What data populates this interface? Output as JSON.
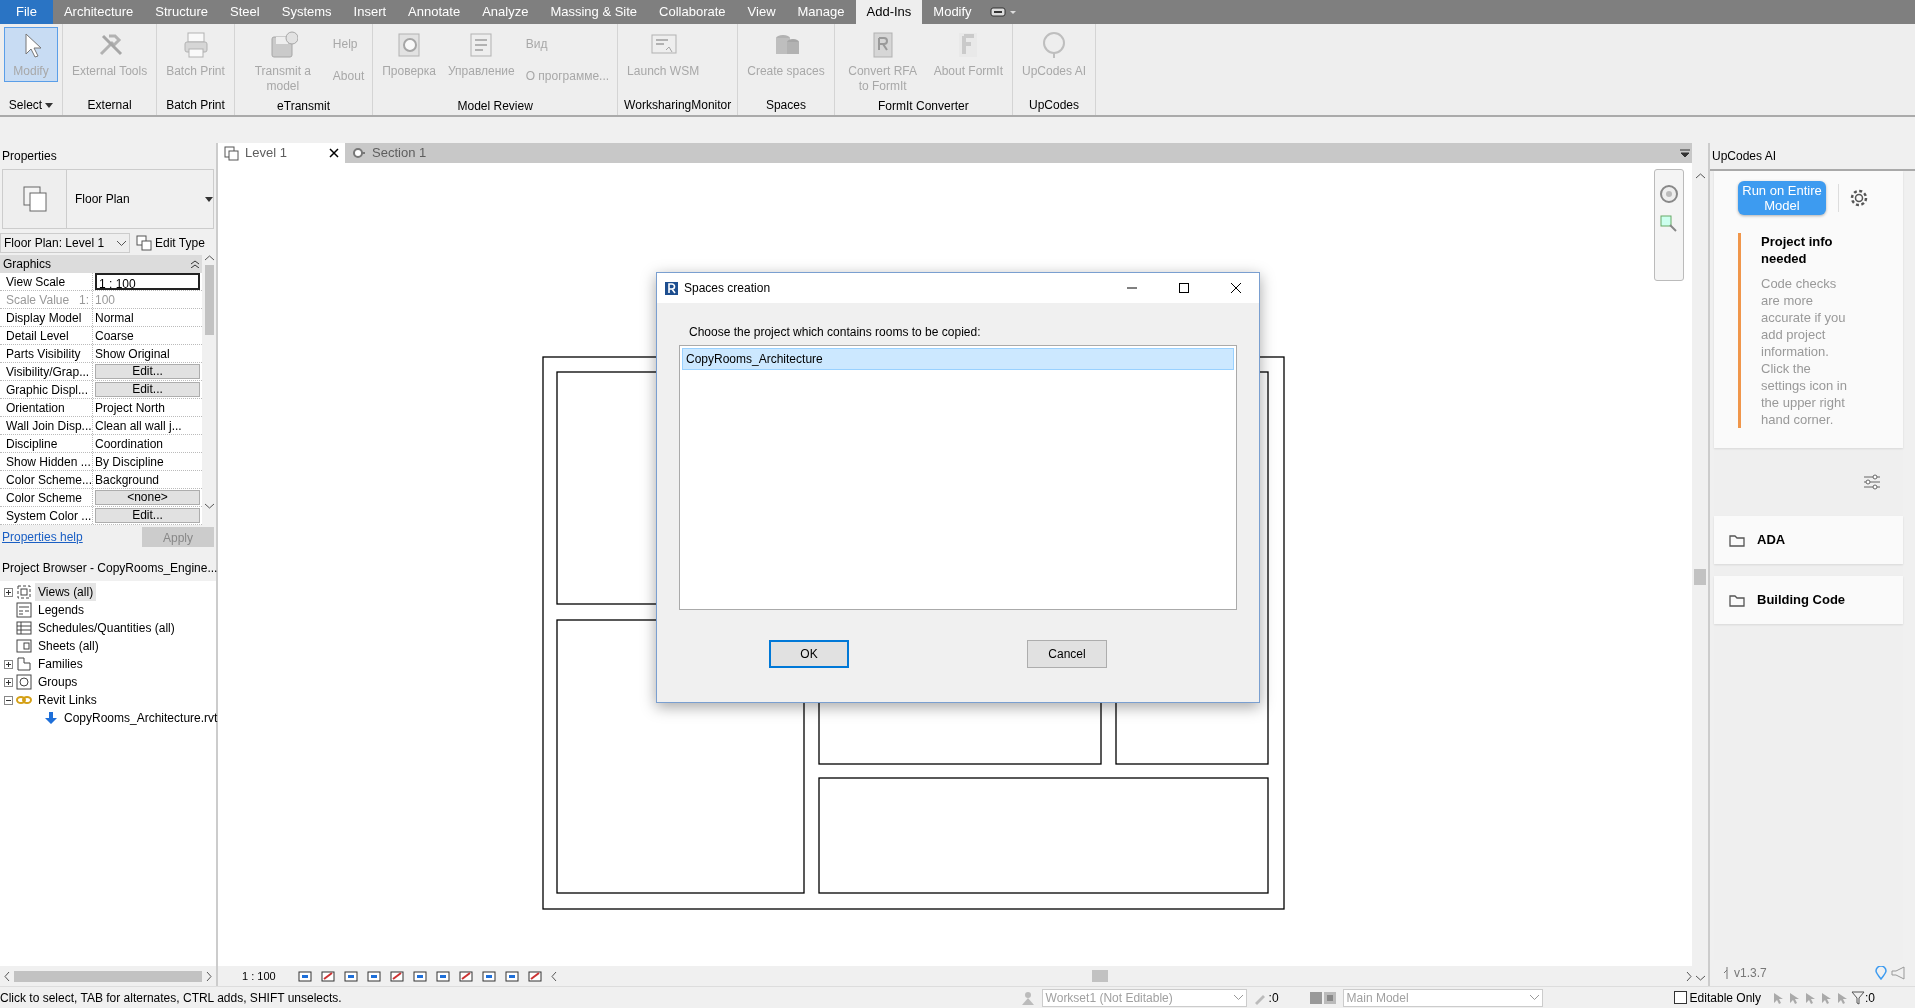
{
  "menu_tabs": [
    {
      "label": "File",
      "kind": "file",
      "selected": false
    },
    {
      "label": "Architecture",
      "kind": "tab",
      "selected": false
    },
    {
      "label": "Structure",
      "kind": "tab",
      "selected": false
    },
    {
      "label": "Steel",
      "kind": "tab",
      "selected": false
    },
    {
      "label": "Systems",
      "kind": "tab",
      "selected": false
    },
    {
      "label": "Insert",
      "kind": "tab",
      "selected": false
    },
    {
      "label": "Annotate",
      "kind": "tab",
      "selected": false
    },
    {
      "label": "Analyze",
      "kind": "tab",
      "selected": false
    },
    {
      "label": "Massing & Site",
      "kind": "tab",
      "selected": false
    },
    {
      "label": "Collaborate",
      "kind": "tab",
      "selected": false
    },
    {
      "label": "View",
      "kind": "tab",
      "selected": false
    },
    {
      "label": "Manage",
      "kind": "tab",
      "selected": false
    },
    {
      "label": "Add-Ins",
      "kind": "tab",
      "selected": true
    },
    {
      "label": "Modify",
      "kind": "tab",
      "selected": false
    }
  ],
  "ribbon_panels": [
    {
      "title": "Select",
      "dropdown": true,
      "buttons": [
        {
          "label": "Modify",
          "kind": "large",
          "selected": true,
          "disabled": true
        }
      ]
    },
    {
      "title": "External",
      "dropdown": false,
      "buttons": [
        {
          "label": "External Tools",
          "kind": "large",
          "selected": false,
          "disabled": true
        }
      ]
    },
    {
      "title": "Batch Print",
      "dropdown": false,
      "buttons": [
        {
          "label": "Batch Print",
          "kind": "large",
          "selected": false,
          "disabled": true
        }
      ]
    },
    {
      "title": "eTransmit",
      "dropdown": false,
      "buttons": [
        {
          "label": "Transmit a model",
          "kind": "large",
          "selected": false,
          "disabled": true
        },
        {
          "label": "Help",
          "kind": "small",
          "selected": false,
          "disabled": true
        },
        {
          "label": "About",
          "kind": "small",
          "selected": false,
          "disabled": true
        }
      ]
    },
    {
      "title": "Model Review",
      "dropdown": false,
      "buttons": [
        {
          "label": "Проверка",
          "kind": "large",
          "selected": false,
          "disabled": true
        },
        {
          "label": "Управление",
          "kind": "large",
          "selected": false,
          "disabled": true
        },
        {
          "label": "Вид",
          "kind": "small",
          "selected": false,
          "disabled": true
        },
        {
          "label": "О программе...",
          "kind": "small",
          "selected": false,
          "disabled": true
        }
      ]
    },
    {
      "title": "WorksharingMonitor",
      "dropdown": false,
      "buttons": [
        {
          "label": "Launch WSM",
          "kind": "large",
          "selected": false,
          "disabled": true
        }
      ]
    },
    {
      "title": "Spaces",
      "dropdown": false,
      "buttons": [
        {
          "label": "Create spaces",
          "kind": "large",
          "selected": false,
          "disabled": true
        }
      ]
    },
    {
      "title": "FormIt Converter",
      "dropdown": false,
      "buttons": [
        {
          "label": "Convert RFA to FormIt",
          "kind": "large",
          "selected": false,
          "disabled": true
        },
        {
          "label": "About FormIt",
          "kind": "large",
          "selected": false,
          "disabled": true
        }
      ]
    },
    {
      "title": "UpCodes",
      "dropdown": false,
      "buttons": [
        {
          "label": "UpCodes AI",
          "kind": "large",
          "selected": false,
          "disabled": true
        }
      ]
    }
  ],
  "properties": {
    "title": "Properties",
    "type_name": "Floor Plan",
    "view_selector": "Floor Plan: Level 1",
    "edit_type": "Edit Type",
    "section": "Graphics",
    "rows": [
      {
        "name": "View Scale",
        "value": "1 : 100",
        "kind": "input",
        "disabled": false
      },
      {
        "name": "Scale Value",
        "unit": "1:",
        "value": "100",
        "kind": "text",
        "disabled": true
      },
      {
        "name": "Display Model",
        "value": "Normal",
        "kind": "text",
        "disabled": false
      },
      {
        "name": "Detail Level",
        "value": "Coarse",
        "kind": "text",
        "disabled": false
      },
      {
        "name": "Parts Visibility",
        "value": "Show Original",
        "kind": "text",
        "disabled": false
      },
      {
        "name": "Visibility/Grap...",
        "value": "Edit...",
        "kind": "button",
        "disabled": false
      },
      {
        "name": "Graphic Displ...",
        "value": "Edit...",
        "kind": "button",
        "disabled": false
      },
      {
        "name": "Orientation",
        "value": "Project North",
        "kind": "text",
        "disabled": false
      },
      {
        "name": "Wall Join Disp...",
        "value": "Clean all wall j...",
        "kind": "text",
        "disabled": false
      },
      {
        "name": "Discipline",
        "value": "Coordination",
        "kind": "text",
        "disabled": false
      },
      {
        "name": "Show Hidden ...",
        "value": "By Discipline",
        "kind": "text",
        "disabled": false
      },
      {
        "name": "Color Scheme...",
        "value": "Background",
        "kind": "text",
        "disabled": false
      },
      {
        "name": "Color Scheme",
        "value": "<none>",
        "kind": "button",
        "disabled": false
      },
      {
        "name": "System Color ...",
        "value": "Edit...",
        "kind": "button",
        "disabled": false
      }
    ],
    "help_link": "Properties help",
    "apply": "Apply"
  },
  "project_browser": {
    "title": "Project Browser - CopyRooms_Engine...",
    "items": [
      {
        "label": "Views (all)",
        "expanded": false,
        "selected": true
      },
      {
        "label": "Legends",
        "selected": false
      },
      {
        "label": "Schedules/Quantities (all)",
        "selected": false
      },
      {
        "label": "Sheets (all)",
        "selected": false
      },
      {
        "label": "Families",
        "expanded": false,
        "selected": false
      },
      {
        "label": "Groups",
        "expanded": false,
        "selected": false
      },
      {
        "label": "Revit Links",
        "expanded": true,
        "selected": false,
        "children": [
          {
            "label": "CopyRooms_Architecture.rvt",
            "selected": false
          }
        ]
      }
    ]
  },
  "view_tabs": [
    {
      "label": "Level 1",
      "selected": true
    },
    {
      "label": "Section 1",
      "selected": false
    }
  ],
  "dialog": {
    "title": "Spaces creation",
    "prompt": "Choose the project which contains rooms to be copied:",
    "items": [
      {
        "label": "CopyRooms_Architecture",
        "selected": true
      }
    ],
    "buttons": [
      {
        "label": "OK",
        "default": true
      },
      {
        "label": "Cancel",
        "default": false
      }
    ]
  },
  "upcodes": {
    "title": "UpCodes AI",
    "run_button": "Run on Entire Model",
    "notice_title": "Project info needed",
    "notice_body": "Code checks are more accurate if you add project information. Click the settings icon in the upper right hand corner.",
    "categories": [
      "ADA",
      "Building Code"
    ],
    "version": "v1.3.7"
  },
  "view_bar": {
    "scale": "1 : 100"
  },
  "status_bar": {
    "message": "Click to select, TAB for alternates, CTRL adds, SHIFT unselects.",
    "workset": "Workset1 (Not Editable)",
    "workset_count": ":0",
    "model": "Main Model",
    "editable_only": {
      "label": "Editable Only",
      "checked": false
    },
    "filter_count": ":0"
  }
}
